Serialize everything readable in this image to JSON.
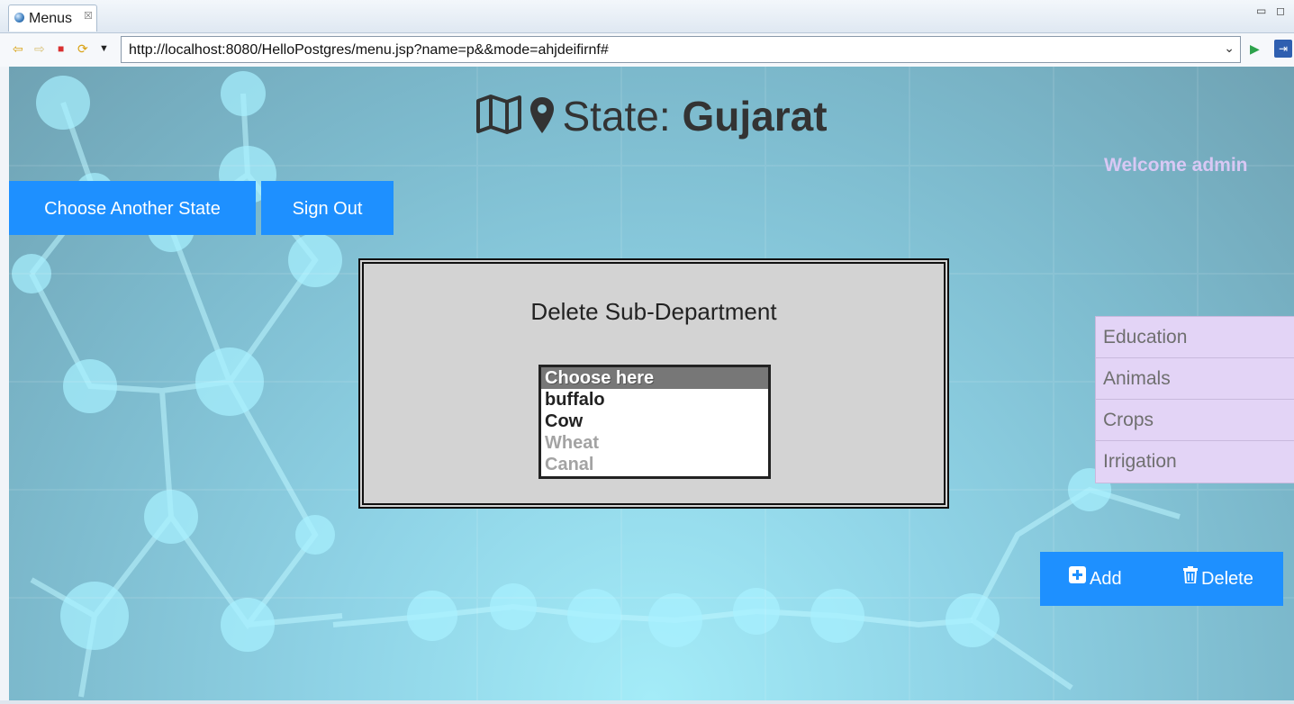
{
  "window": {
    "tab_title": "Menus",
    "tab_close": "☒",
    "minimize": "▭",
    "maximize": "◻"
  },
  "toolbar": {
    "back_icon": "⇦",
    "forward_icon": "⇨",
    "stop_icon": "■",
    "refresh_icon": "⟳",
    "menu_icon": "▼",
    "url": "http://localhost:8080/HelloPostgres/menu.jsp?name=p&&mode=ahjdeifirnf#",
    "url_dropdown_icon": "⌄",
    "go_icon": "▶",
    "external_icon": "⇥"
  },
  "header": {
    "state_prefix": "State:",
    "state_name": "Gujarat",
    "map_icon": "map-icon",
    "marker_icon": "map-marker-icon"
  },
  "welcome": "Welcome admin",
  "buttons": {
    "choose_state": "Choose Another State",
    "sign_out": "Sign Out"
  },
  "panel": {
    "title": "Delete Sub-Department",
    "options": [
      {
        "label": "Choose here",
        "state": "selected"
      },
      {
        "label": "buffalo",
        "state": "normal"
      },
      {
        "label": "Cow",
        "state": "normal"
      },
      {
        "label": "Wheat",
        "state": "disabled"
      },
      {
        "label": "Canal",
        "state": "disabled"
      }
    ]
  },
  "sidemenu": {
    "items": [
      {
        "label": "Education"
      },
      {
        "label": "Animals"
      },
      {
        "label": "Crops"
      },
      {
        "label": "Irrigation"
      }
    ]
  },
  "actions": {
    "add_label": "Add",
    "add_icon": "plus-square-icon",
    "delete_label": "Delete",
    "delete_icon": "trash-icon"
  },
  "colors": {
    "primary_button": "#1e90ff",
    "welcome_text": "#d8c8f4",
    "side_menu_bg": "#e3d4f6",
    "panel_bg": "#d3d3d3"
  }
}
